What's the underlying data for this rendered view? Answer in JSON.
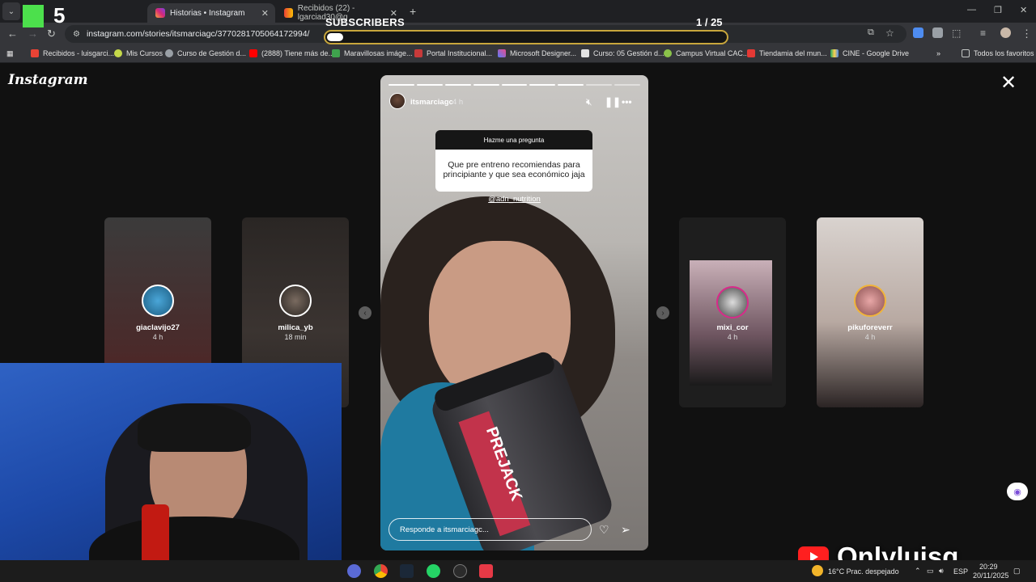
{
  "browser": {
    "tabs": [
      {
        "title": "Historias • Instagram",
        "active": true
      },
      {
        "title": "Recibidos (22) - lgarciad30@g",
        "active": false
      }
    ],
    "url": "instagram.com/stories/itsmarciagc/3770281705064172994/",
    "bookmarks": [
      "Recibidos - luisgarci...",
      "Mis Cursos",
      "Curso de Gestión d...",
      "(2888) Tiene más de...",
      "Maravillosas imáge...",
      "Portal Institucional...",
      "Microsoft Designer...",
      "Curso: 05 Gestión d...",
      "Campus Virtual CAC...",
      "Tiendamia del mun...",
      "CINE - Google Drive"
    ],
    "all_bookmarks": "Todos los favoritos"
  },
  "instagram": {
    "logo": "Instagram",
    "side_stories": [
      {
        "user": "giaclavijo27",
        "time": "4 h"
      },
      {
        "user": "milica_yb",
        "time": "18 min"
      },
      {
        "user": "mixi_cor",
        "time": "4 h"
      },
      {
        "user": "pikuforeverr",
        "time": "4 h"
      }
    ],
    "story": {
      "user": "itsmarciagc",
      "time": "4 h",
      "progress_total": 9,
      "progress_done": 7,
      "question_header": "Hazme una pregunta",
      "question_text": "Que pre entreno recomiendas para principiante y que sea económico jaja",
      "mention": "@adn_nutrition",
      "product_brand": "PREJACK",
      "reply_placeholder": "Responde a itsmarciagc..."
    }
  },
  "overlay": {
    "subs_label": "SUBSCRIBERS",
    "subs_count": "1  / 25",
    "subs_progress": 0.04,
    "channel": "Onlyluisg",
    "logo_text": "5"
  },
  "taskbar": {
    "weather": "16°C  Prac. despejado",
    "lang": "ESP",
    "time": "20:29",
    "date": "20/11/2025"
  }
}
